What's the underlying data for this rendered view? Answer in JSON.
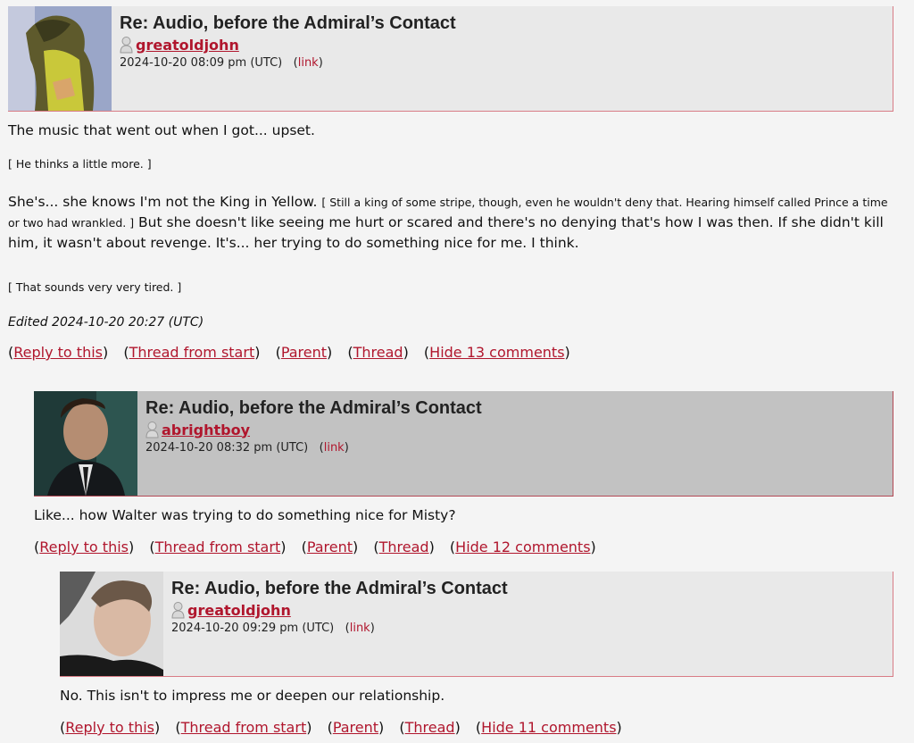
{
  "comments": [
    {
      "subject": "Re: Audio, before the Admiral’s Contact",
      "user": "greatoldjohn",
      "date": "2024-10-20 08:09 pm (UTC)",
      "link_label": "link",
      "body": {
        "line1": "The music that went out when I got... upset.",
        "aside1": "[ He thinks a little more. ]",
        "para_start": "She's... she knows I'm not the King in Yellow.",
        "para_aside": "[ Still a king of some stripe, though, even he wouldn't deny that. Hearing himself called Prince a time or two had wrankled. ]",
        "para_end": "But she doesn't like seeing me hurt or scared and there's no denying that's how I was then. If she didn't kill him, it wasn't about revenge. It's... her trying to do something nice for me. I think.",
        "aside2": "[ That sounds very very tired. ]"
      },
      "edited": "Edited 2024-10-20 20:27 (UTC)",
      "actions": {
        "reply": "Reply to this",
        "thread_start": "Thread from start",
        "parent": "Parent",
        "thread": "Thread",
        "hide": "Hide 13 comments"
      }
    },
    {
      "subject": "Re: Audio, before the Admiral’s Contact",
      "user": "abrightboy",
      "date": "2024-10-20 08:32 pm (UTC)",
      "link_label": "link",
      "body": "Like... how Walter was trying to do something nice for Misty?",
      "actions": {
        "reply": "Reply to this",
        "thread_start": "Thread from start",
        "parent": "Parent",
        "thread": "Thread",
        "hide": "Hide 12 comments"
      }
    },
    {
      "subject": "Re: Audio, before the Admiral’s Contact",
      "user": "greatoldjohn",
      "date": "2024-10-20 09:29 pm (UTC)",
      "link_label": "link",
      "body": "No. This isn't to impress me or deepen our relationship.",
      "actions": {
        "reply": "Reply to this",
        "thread_start": "Thread from start",
        "parent": "Parent",
        "thread": "Thread",
        "hide": "Hide 11 comments"
      }
    }
  ],
  "colors": {
    "link": "#b0162d",
    "header_light": "#e9e9e9",
    "header_dark": "#c2c2c2",
    "border": "#d87c86"
  }
}
